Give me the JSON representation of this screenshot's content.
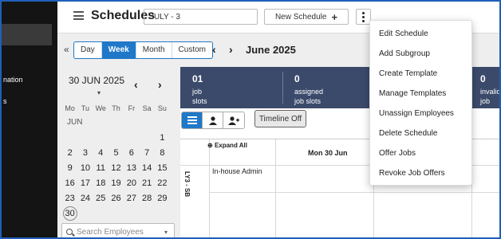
{
  "sidebar": {
    "items": [
      {
        "label": "nation"
      },
      {
        "label": "s"
      }
    ]
  },
  "header": {
    "title": "Schedules",
    "selected_schedule": "JULY - 3",
    "new_schedule_label": "New Schedule",
    "new_schedule_icon": "+"
  },
  "toolbar": {
    "collapse_icon": "«",
    "views": [
      "Day",
      "Week",
      "Month",
      "Custom"
    ],
    "active_view": "Week",
    "prev_icon": "‹",
    "next_icon": "›",
    "period_title": "June 2025"
  },
  "calendar": {
    "selected_date": "30 JUN 2025",
    "caret": "▾",
    "prev_icon": "‹",
    "next_icon": "›",
    "weekdays": [
      "Mo",
      "Tu",
      "We",
      "Th",
      "Fr",
      "Sa",
      "Su"
    ],
    "month_label": "JUN",
    "weeks": [
      [
        "",
        "",
        "",
        "",
        "",
        "",
        "1"
      ],
      [
        "2",
        "3",
        "4",
        "5",
        "6",
        "7",
        "8"
      ],
      [
        "9",
        "10",
        "11",
        "12",
        "13",
        "14",
        "15"
      ],
      [
        "16",
        "17",
        "18",
        "19",
        "20",
        "21",
        "22"
      ],
      [
        "23",
        "24",
        "25",
        "26",
        "27",
        "28",
        "29"
      ],
      [
        "30",
        "",
        "",
        "",
        "",
        "",
        ""
      ]
    ],
    "today": "30",
    "search_placeholder": "Search Employees",
    "search_caret": "▾"
  },
  "stats": [
    {
      "value": "01",
      "line1": "job",
      "line2": "slots"
    },
    {
      "value": "0",
      "line1": "assigned",
      "line2": "job slots"
    },
    {
      "value": "0",
      "line1": "invalid",
      "line2": "job"
    }
  ],
  "subbar": {
    "timeline_label": "Timeline Off"
  },
  "grid": {
    "expand_all_label": "Expand All",
    "expand_icon": "⊕",
    "day_header": "Mon 30 Jun",
    "side_label": "LY3 - SB",
    "group_name": "In-house Admin"
  },
  "menu": {
    "items": [
      "Edit Schedule",
      "Add Subgroup",
      "Create Template",
      "Manage Templates",
      "Unassign Employees",
      "Delete Schedule",
      "Offer Jobs",
      "Revoke Job Offers"
    ]
  },
  "colors": {
    "accent": "#1f78c8",
    "sidebar_bg": "#141414",
    "stats_bg": "#3b4a6b",
    "shift_bar": "#e26b78"
  }
}
